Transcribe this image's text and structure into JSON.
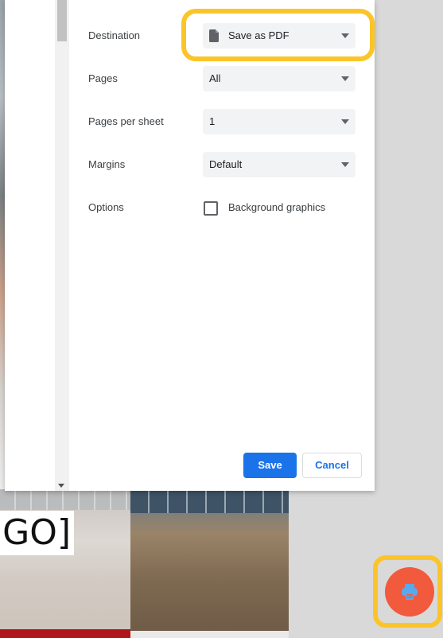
{
  "dialog": {
    "destination": {
      "label": "Destination",
      "value": "Save as PDF",
      "icon": "file-icon"
    },
    "pages": {
      "label": "Pages",
      "value": "All"
    },
    "pages_per_sheet": {
      "label": "Pages per sheet",
      "value": "1"
    },
    "margins": {
      "label": "Margins",
      "value": "Default"
    },
    "options": {
      "label": "Options",
      "checkbox_label": "Background graphics",
      "checked": false
    },
    "save_label": "Save",
    "cancel_label": "Cancel"
  },
  "background": {
    "logo_text": "GO]"
  },
  "fab": {
    "icon": "print-icon",
    "color": "#f15a3c"
  },
  "colors": {
    "highlight": "#fbc52a",
    "primary": "#1a73e8",
    "select_bg": "#f1f3f4"
  }
}
